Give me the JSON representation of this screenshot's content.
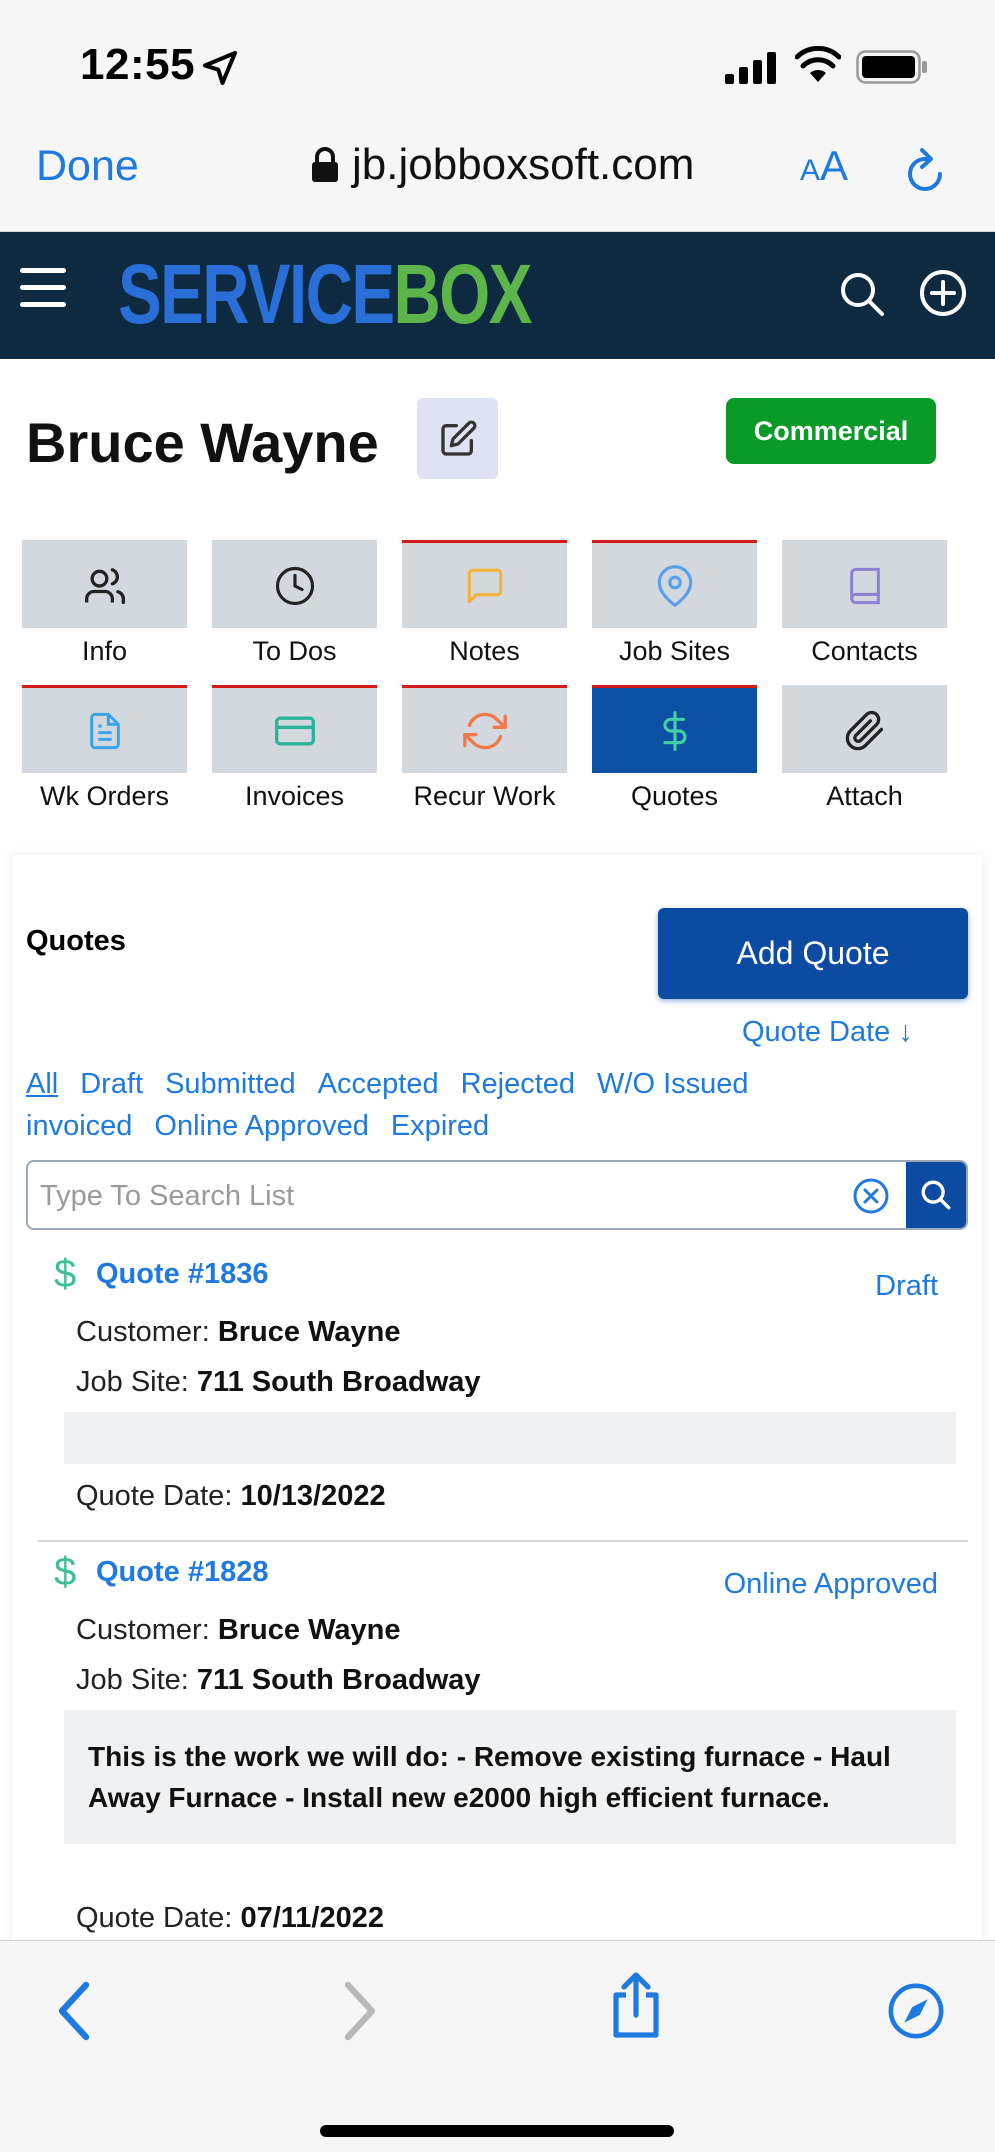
{
  "status_bar": {
    "time": "12:55"
  },
  "browser": {
    "done_label": "Done",
    "url": "jb.jobboxsoft.com",
    "text_size_small": "A",
    "text_size_large": "A"
  },
  "app": {
    "logo_part1": "SERVICE",
    "logo_part2": "BOX"
  },
  "customer": {
    "name": "Bruce Wayne",
    "type_badge": "Commercial"
  },
  "tiles": [
    {
      "label": "Info",
      "icon": "users-icon"
    },
    {
      "label": "To Dos",
      "icon": "clock-icon"
    },
    {
      "label": "Notes",
      "icon": "message-icon"
    },
    {
      "label": "Job Sites",
      "icon": "map-pin-icon"
    },
    {
      "label": "Contacts",
      "icon": "book-icon"
    },
    {
      "label": "Wk Orders",
      "icon": "document-icon"
    },
    {
      "label": "Invoices",
      "icon": "credit-card-icon"
    },
    {
      "label": "Recur Work",
      "icon": "refresh-icon"
    },
    {
      "label": "Quotes",
      "icon": "dollar-icon"
    },
    {
      "label": "Attach",
      "icon": "paperclip-icon"
    }
  ],
  "quotes_section": {
    "heading": "Quotes",
    "add_button": "Add Quote",
    "sort_label": "Quote Date",
    "filters_row1": [
      "All",
      "Draft",
      "Submitted",
      "Accepted",
      "Rejected",
      "W/O Issued"
    ],
    "filters_row2": [
      "invoiced",
      "Online Approved",
      "Expired"
    ],
    "search_placeholder": "Type To Search List"
  },
  "quotes": [
    {
      "number": "Quote #1836",
      "status": "Draft",
      "customer_label": "Customer:",
      "customer": "Bruce Wayne",
      "job_site_label": "Job Site:",
      "job_site": "711 South Broadway",
      "description": "",
      "date_label": "Quote Date:",
      "date": "10/13/2022"
    },
    {
      "number": "Quote #1828",
      "status": "Online Approved",
      "customer_label": "Customer:",
      "customer": "Bruce Wayne",
      "job_site_label": "Job Site:",
      "job_site": "711 South Broadway",
      "description": "This is the work we will do: - Remove existing furnace - Haul Away Furnace - Install new e2000 high efficient furnace.",
      "date_label": "Quote Date:",
      "date": "07/11/2022"
    }
  ],
  "colors": {
    "brand_dark": "#0e2a40",
    "primary": "#0b4ba1",
    "link": "#1f7ae0",
    "badge_green": "#0a9a27",
    "tile_grey": "#d3d8de",
    "tile_marker_red": "#d51a1a"
  }
}
